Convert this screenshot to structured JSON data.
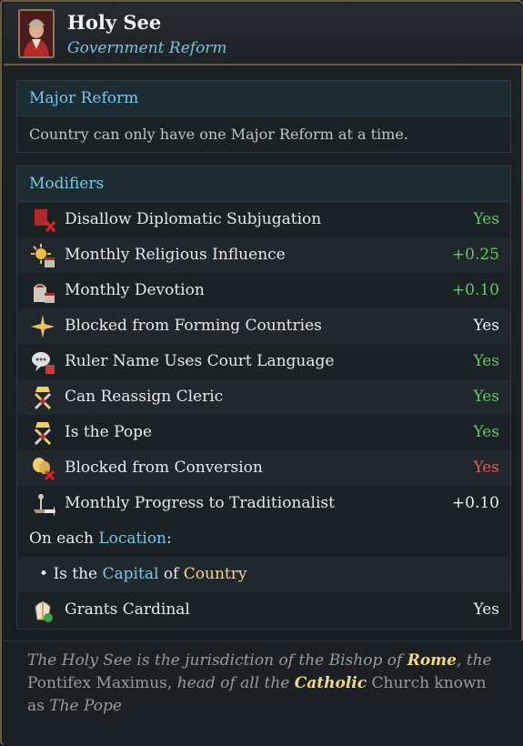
{
  "header": {
    "title": "Holy See",
    "subtitle": "Government Reform"
  },
  "major_reform": {
    "title": "Major Reform",
    "text": "Country can only have one Major Reform at a time."
  },
  "modifiers": {
    "title": "Modifiers",
    "rows": [
      {
        "label": "Disallow Diplomatic Subjugation",
        "value": "Yes",
        "color": "#5fca5f",
        "icon": "banner-cross-icon"
      },
      {
        "label": "Monthly Religious Influence",
        "value": "+0.25",
        "color": "#5fca5f",
        "icon": "sun-calendar-icon"
      },
      {
        "label": "Monthly Devotion",
        "value": "+0.10",
        "color": "#5fca5f",
        "icon": "church-calendar-icon"
      },
      {
        "label": "Blocked from Forming Countries",
        "value": "Yes",
        "color": "#eeeeee",
        "icon": "star-burst-icon"
      },
      {
        "label": "Ruler Name Uses Court Language",
        "value": "Yes",
        "color": "#5fca5f",
        "icon": "speech-bubble-icon"
      },
      {
        "label": "Can Reassign Cleric",
        "value": "Yes",
        "color": "#5fca5f",
        "icon": "papal-keys-icon"
      },
      {
        "label": "Is the Pope",
        "value": "Yes",
        "color": "#5fca5f",
        "icon": "papal-keys-icon"
      },
      {
        "label": "Blocked from Conversion",
        "value": "Yes",
        "color": "#e05858",
        "icon": "masks-cross-icon"
      },
      {
        "label": "Monthly Progress to Traditionalist",
        "value": "+0.10",
        "color": "#eeeeee",
        "icon": "scales-arrow-icon"
      }
    ],
    "location_line": {
      "prefix": "On each",
      "link": "Location",
      "suffix": ":"
    },
    "condition": {
      "bullet": "•",
      "part1": "Is the",
      "link1": "Capital",
      "part2": "of",
      "link2": "Country"
    },
    "grant": {
      "label": "Grants Cardinal",
      "value": "Yes",
      "icon": "mitre-icon"
    }
  },
  "flavor": {
    "t1": "The Holy See is the jurisdiction of the Bishop of",
    "rome": "Rome",
    "t2": ", the",
    "t3": "Pontifex Maximus,",
    "t4": "head of all the",
    "catholic": "Catholic",
    "t5": "Church known as",
    "t6": "The Pope"
  },
  "colors": {
    "accent": "#78c8e6",
    "positive": "#5fca5f",
    "negative": "#e05858",
    "highlight": "#f2d97a",
    "border": "#6b5a3c"
  }
}
